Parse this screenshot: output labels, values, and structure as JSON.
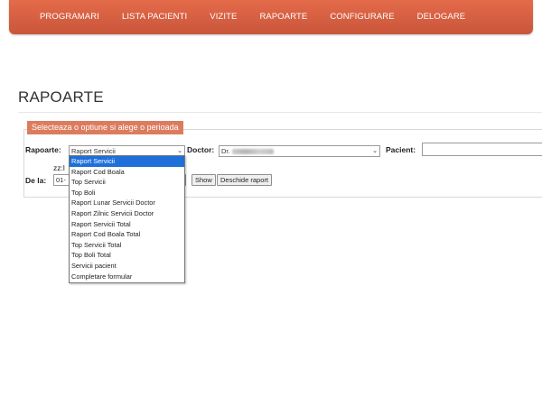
{
  "nav": {
    "items": [
      "PROGRAMARI",
      "LISTA PACIENTI",
      "VIZITE",
      "RAPOARTE",
      "CONFIGURARE",
      "DELOGARE"
    ]
  },
  "page": {
    "title": "RAPOARTE"
  },
  "panel": {
    "legend": "Selecteaza o optiune si alege o perioada"
  },
  "form": {
    "rapoarte_label": "Rapoarte:",
    "rapoarte_value": "Raport Servicii",
    "doctor_label": "Doctor:",
    "doctor_value": "Dr.",
    "pacient_label": "Pacient:",
    "pacient_value": "",
    "zz_text": "zz:l",
    "dela_label": "De la:",
    "dela_value": "01-",
    "show_button": "Show",
    "deschide_button": "Deschide raport"
  },
  "dropdown": {
    "options": [
      "Raport Servicii",
      "Raport Cod Boala",
      "Top Servicii",
      "Top Boli",
      "Raport Lunar Servicii Doctor",
      "Raport Zilnic Servicii Doctor",
      "Raport Servicii Total",
      "Raport Cod Boala Total",
      "Top Servicii Total",
      "Top Boli Total",
      "Servicii pacient",
      "Completare formular"
    ],
    "selected_index": 0
  },
  "colors": {
    "navbar": "#d35f41",
    "legend": "#dc7c5f",
    "selection": "#1e6fd9"
  }
}
